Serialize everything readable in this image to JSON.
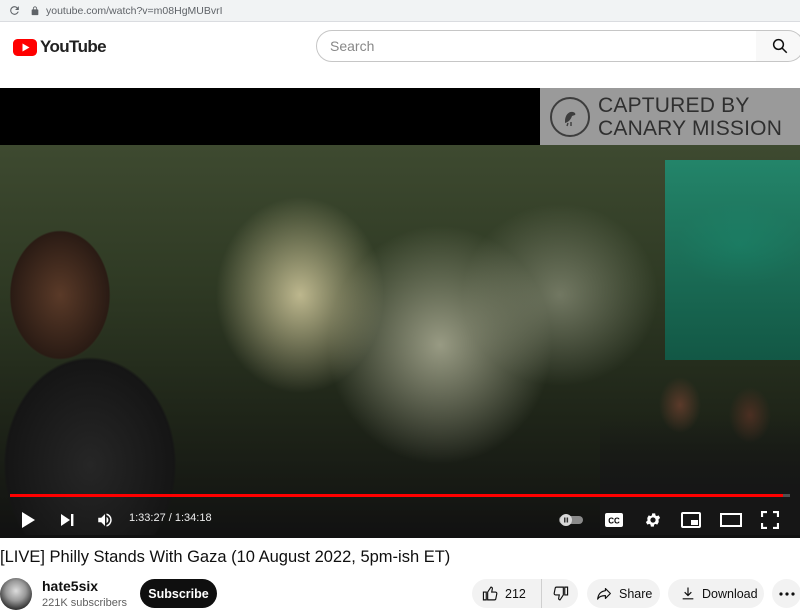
{
  "browser": {
    "url": "youtube.com/watch?v=m08HgMUBvrI"
  },
  "masthead": {
    "logo_text": "YouTube",
    "search_placeholder": "Search"
  },
  "player": {
    "watermark_line1": "CAPTURED BY",
    "watermark_line2": "CANARY MISSION",
    "current_time": "1:33:27",
    "duration": "1:34:18",
    "time_display": "1:33:27 / 1:34:18",
    "progress_fraction": 0.991,
    "autoplay_on": false,
    "accent_color": "#ff0000"
  },
  "video": {
    "title": "[LIVE] Philly Stands With Gaza (10 August 2022, 5pm-ish ET)"
  },
  "channel": {
    "name": "hate5six",
    "subscribers": "221K subscribers",
    "subscribe_label": "Subscribe"
  },
  "actions": {
    "like_count": "212",
    "share_label": "Share",
    "download_label": "Download"
  },
  "icons": [
    "reload-icon",
    "lock-icon",
    "youtube-logo-icon",
    "search-icon",
    "canary-logo-icon",
    "play-icon",
    "next-icon",
    "volume-icon",
    "autoplay-toggle-icon",
    "captions-icon",
    "settings-icon",
    "miniplayer-icon",
    "theater-icon",
    "fullscreen-icon",
    "like-icon",
    "dislike-icon",
    "share-icon",
    "download-icon",
    "more-icon"
  ]
}
